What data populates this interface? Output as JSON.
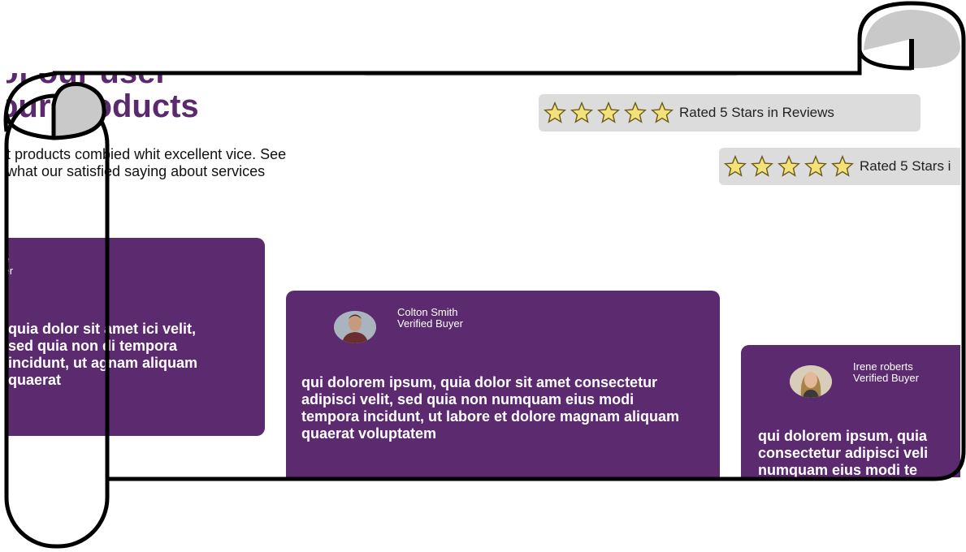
{
  "heading": {
    "line1": "of our user",
    "line2": "our products"
  },
  "intro": "t products combied whit excellent vice. See what our satisfied  saying about services",
  "ratings": [
    {
      "label": "Rated 5 Stars in Reviews",
      "stars": 5
    },
    {
      "label": "Rated 5 Stars i",
      "stars": 5
    }
  ],
  "cards": [
    {
      "name": "ce",
      "role": "yer",
      "quote": "quia dolor sit amet ici velit, sed quia non di tempora incidunt, ut agnam aliquam quaerat"
    },
    {
      "name": "Colton Smith",
      "role": "Verified Buyer",
      "quote": "qui dolorem ipsum, quia dolor sit amet consectetur adipisci velit, sed quia non numquam eius modi tempora incidunt, ut labore et dolore magnam aliquam quaerat voluptatem"
    },
    {
      "name": "Irene roberts",
      "role": "Verified Buyer",
      "quote": "qui dolorem ipsum, quia consectetur adipisci veli numquam eius modi te"
    }
  ],
  "colors": {
    "brand": "#5c2a6e",
    "star_fill": "#f3e27a",
    "rating_bg": "#dcdcdc"
  }
}
